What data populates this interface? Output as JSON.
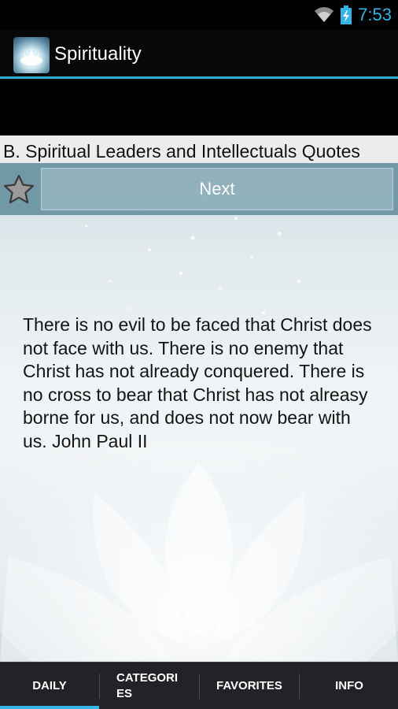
{
  "status_bar": {
    "time": "7:53"
  },
  "app": {
    "title": "Spirituality"
  },
  "category": {
    "title": "B. Spiritual Leaders and Intellectuals Quotes"
  },
  "toolbar": {
    "next_label": "Next"
  },
  "quote": {
    "text": "There is no evil to be faced that Christ does not face with us. There is no enemy that Christ has not already conquered. There is no cross to bear that Christ has not alreasy borne for us, and does not now bear with us. John Paul II"
  },
  "tabs": [
    {
      "label": "DAILY",
      "selected": true
    },
    {
      "label": "CATEGORIES",
      "selected": false
    },
    {
      "label": "FAVORITES",
      "selected": false
    },
    {
      "label": "INFO",
      "selected": false
    }
  ],
  "colors": {
    "accent": "#33b5e5",
    "action_bar": "#080808",
    "tab_bar": "#222326"
  }
}
